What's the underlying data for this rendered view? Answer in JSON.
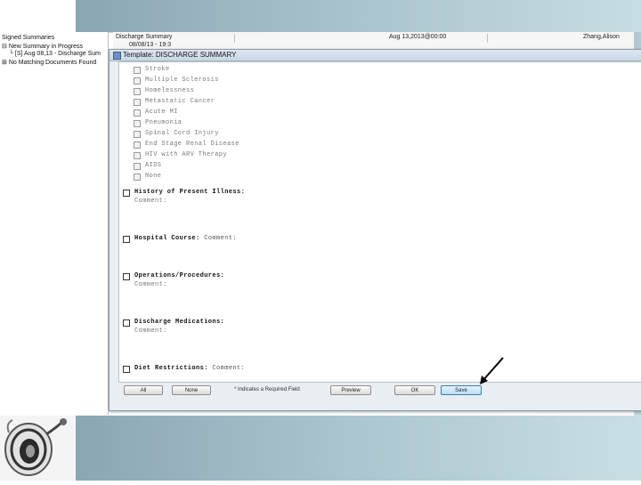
{
  "tree": {
    "items": [
      {
        "label": "Signed Summaries"
      },
      {
        "label": "New Summary in Progress"
      },
      {
        "label": "[S] Aug 08,13 - Discharge Sum"
      },
      {
        "label": "No Matching Documents Found"
      }
    ]
  },
  "doc_header": {
    "title": "Discharge Summary",
    "date": "Aug 13,2013@00:00",
    "author": "Zhang,Alison",
    "sub": "08/08/13 - 19:3"
  },
  "dialog": {
    "title": "Template: DISCHARGE SUMMARY",
    "items": [
      {
        "label": "Stroke"
      },
      {
        "label": "Multiple Sclerosis"
      },
      {
        "label": "Homelessness"
      },
      {
        "label": "Metastatic Cancer"
      },
      {
        "label": "Acute MI"
      },
      {
        "label": "Pneumonia"
      },
      {
        "label": "Spinal Cord Injury"
      },
      {
        "label": "End Stage Renal Disease"
      },
      {
        "label": "HIV with ARV Therapy"
      },
      {
        "label": "AIDS"
      },
      {
        "label": "None"
      }
    ],
    "sections": [
      {
        "label": "History of Present Illness:",
        "comment": "Comment:",
        "inline": ""
      },
      {
        "label": "Hospital Course:",
        "comment": "",
        "inline": "Comment:"
      },
      {
        "label": "Operations/Procedures:",
        "comment": "Comment:",
        "inline": ""
      },
      {
        "label": "Discharge Medications:",
        "comment": "Comment:",
        "inline": ""
      },
      {
        "label": "Diet Restrictions:",
        "comment": "",
        "inline": "Comment:"
      }
    ],
    "buttons": {
      "all": "All",
      "none": "None",
      "required_label": "* Indicates a Required Field",
      "preview": "Preview",
      "ok": "OK",
      "save": "Save"
    }
  },
  "colors": {
    "accent_top": "#8aa6b3",
    "accent_light": "#c6dde3",
    "save_button": "#bcdcf3"
  }
}
